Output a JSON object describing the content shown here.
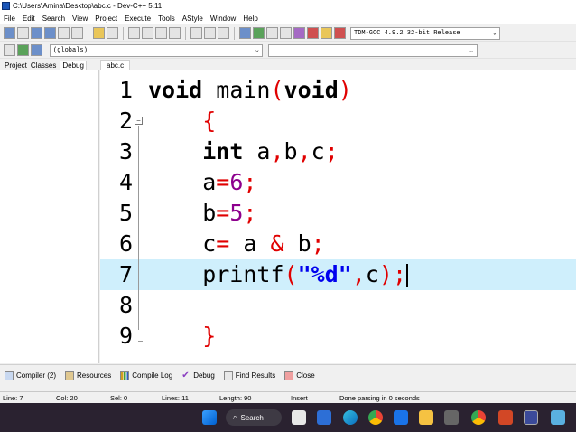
{
  "window": {
    "title": "C:\\Users\\Amina\\Desktop\\abc.c - Dev-C++ 5.11"
  },
  "menu": [
    "File",
    "Edit",
    "Search",
    "View",
    "Project",
    "Execute",
    "Tools",
    "AStyle",
    "Window",
    "Help"
  ],
  "toolbar": {
    "compiler": "TDM-GCC 4.9.2 32-bit Release",
    "scope": "(globals)"
  },
  "panel_tabs": [
    "Project",
    "Classes",
    "Debug"
  ],
  "file_tab": "abc.c",
  "editor": {
    "lines": [
      {
        "n": "1",
        "tokens": [
          {
            "t": "void",
            "c": "kw"
          },
          {
            "t": " main",
            "c": "id"
          },
          {
            "t": "(",
            "c": "op"
          },
          {
            "t": "void",
            "c": "kw"
          },
          {
            "t": ")",
            "c": "op"
          }
        ]
      },
      {
        "n": "2",
        "tokens": [
          {
            "t": "    ",
            "c": "id"
          },
          {
            "t": "{",
            "c": "op"
          }
        ]
      },
      {
        "n": "3",
        "tokens": [
          {
            "t": "    ",
            "c": "id"
          },
          {
            "t": "int",
            "c": "kw"
          },
          {
            "t": " a",
            "c": "id"
          },
          {
            "t": ",",
            "c": "op"
          },
          {
            "t": "b",
            "c": "id"
          },
          {
            "t": ",",
            "c": "op"
          },
          {
            "t": "c",
            "c": "id"
          },
          {
            "t": ";",
            "c": "op"
          }
        ]
      },
      {
        "n": "4",
        "tokens": [
          {
            "t": "    a",
            "c": "id"
          },
          {
            "t": "=",
            "c": "op"
          },
          {
            "t": "6",
            "c": "num"
          },
          {
            "t": ";",
            "c": "op"
          }
        ]
      },
      {
        "n": "5",
        "tokens": [
          {
            "t": "    b",
            "c": "id"
          },
          {
            "t": "=",
            "c": "op"
          },
          {
            "t": "5",
            "c": "num"
          },
          {
            "t": ";",
            "c": "op"
          }
        ]
      },
      {
        "n": "6",
        "tokens": [
          {
            "t": "    c",
            "c": "id"
          },
          {
            "t": "=",
            "c": "op"
          },
          {
            "t": " a ",
            "c": "id"
          },
          {
            "t": "&",
            "c": "op"
          },
          {
            "t": " b",
            "c": "id"
          },
          {
            "t": ";",
            "c": "op"
          }
        ]
      },
      {
        "n": "7",
        "tokens": [
          {
            "t": "    printf",
            "c": "id"
          },
          {
            "t": "(",
            "c": "op"
          },
          {
            "t": "\"%d\"",
            "c": "str"
          },
          {
            "t": ",",
            "c": "op"
          },
          {
            "t": "c",
            "c": "id"
          },
          {
            "t": ");",
            "c": "op"
          }
        ]
      },
      {
        "n": "8",
        "tokens": []
      },
      {
        "n": "9",
        "tokens": [
          {
            "t": "    ",
            "c": "id"
          },
          {
            "t": "}",
            "c": "op"
          }
        ]
      }
    ],
    "highlighted_line": 7
  },
  "bottom_tabs": [
    {
      "icon": "compiler-icon",
      "label": "Compiler (2)"
    },
    {
      "icon": "resources-icon",
      "label": "Resources"
    },
    {
      "icon": "compile-log-icon",
      "label": "Compile Log"
    },
    {
      "icon": "debug-icon",
      "label": "Debug"
    },
    {
      "icon": "find-results-icon",
      "label": "Find Results"
    },
    {
      "icon": "close-icon",
      "label": "Close"
    }
  ],
  "status": {
    "line": "Line:    7",
    "col": "Col:    20",
    "sel": "Sel:    0",
    "lines": "Lines:    11",
    "length": "Length:    90",
    "mode": "Insert",
    "message": "Done parsing in 0 seconds"
  },
  "taskbar": {
    "search_label": "Search"
  },
  "colors": {
    "keyword": "#000000",
    "operator": "#e00000",
    "number": "#8d008d",
    "string": "#0000ee",
    "highlight": "#cfeffc"
  }
}
